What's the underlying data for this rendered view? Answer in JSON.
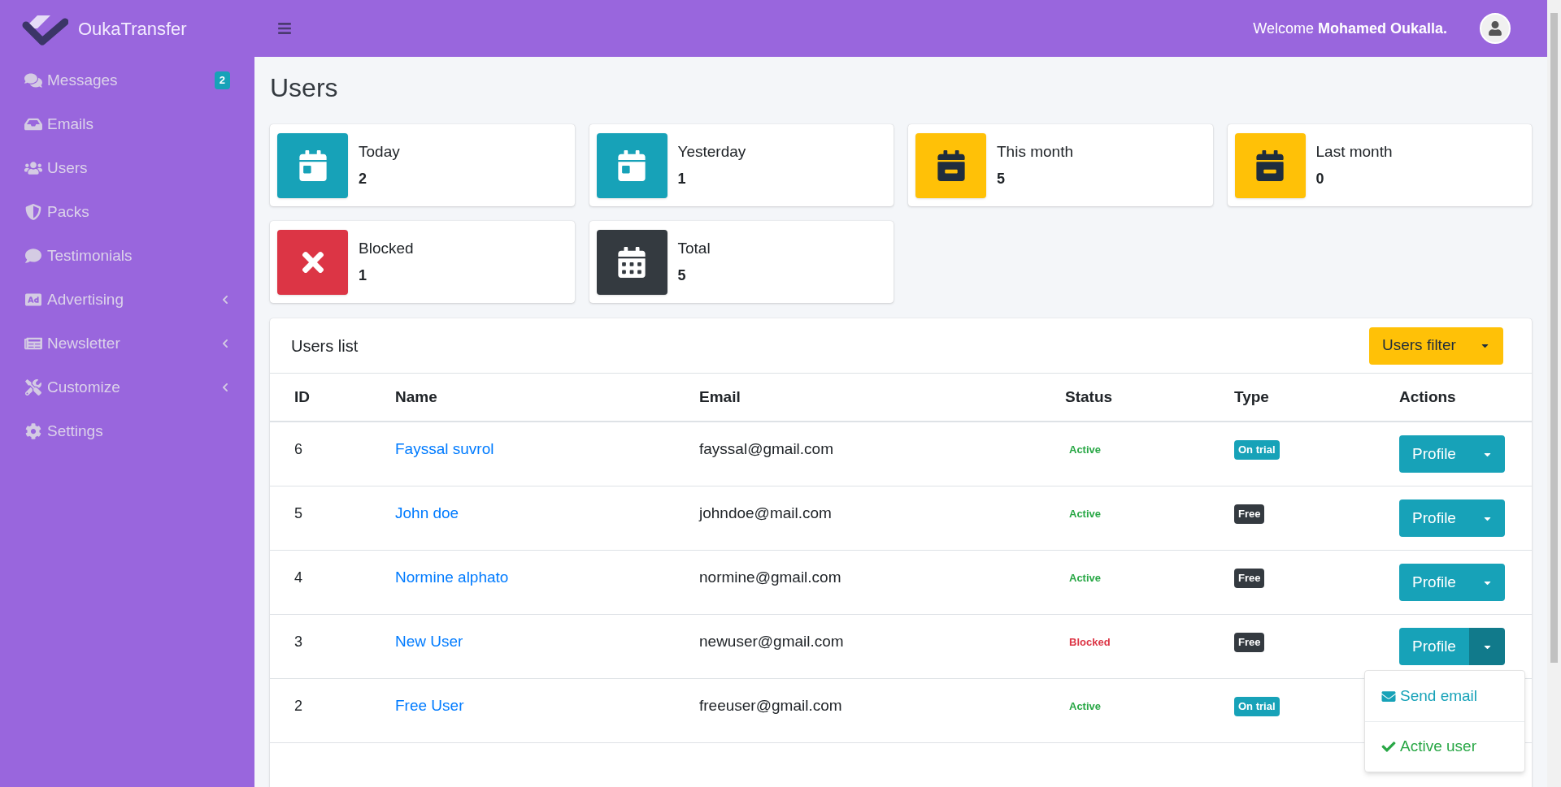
{
  "brand": {
    "name": "OukaTransfer"
  },
  "sidebar": {
    "items": [
      {
        "label": "Messages",
        "badge": "2"
      },
      {
        "label": "Emails"
      },
      {
        "label": "Users"
      },
      {
        "label": "Packs"
      },
      {
        "label": "Testimonials"
      },
      {
        "label": "Advertising",
        "expanded": false
      },
      {
        "label": "Newsletter",
        "expanded": false
      },
      {
        "label": "Customize",
        "expanded": false
      },
      {
        "label": "Settings"
      }
    ]
  },
  "header": {
    "welcome": "Welcome",
    "user_name": "Mohamed Oukalla."
  },
  "page_title": "Users",
  "stats": [
    {
      "label": "Today",
      "value": "2",
      "color": "#17a2b8"
    },
    {
      "label": "Yesterday",
      "value": "1",
      "color": "#17a2b8"
    },
    {
      "label": "This month",
      "value": "5",
      "color": "#ffc107"
    },
    {
      "label": "Last month",
      "value": "0",
      "color": "#ffc107"
    },
    {
      "label": "Blocked",
      "value": "1",
      "color": "#dc3545"
    },
    {
      "label": "Total",
      "value": "5",
      "color": "#343a40"
    }
  ],
  "users_list": {
    "title": "Users list",
    "filter_button": "Users filter",
    "columns": [
      "ID",
      "Name",
      "Email",
      "Status",
      "Type",
      "Actions"
    ],
    "rows": [
      {
        "id": "6",
        "name": "Fayssal suvrol",
        "email": "fayssal@gmail.com",
        "status": {
          "text": "Active",
          "kind": "active"
        },
        "type": {
          "text": "On trial",
          "kind": "trial"
        },
        "action": "Profile",
        "menu_open": false
      },
      {
        "id": "5",
        "name": "John doe",
        "email": "johndoe@mail.com",
        "status": {
          "text": "Active",
          "kind": "active"
        },
        "type": {
          "text": "Free",
          "kind": "free"
        },
        "action": "Profile",
        "menu_open": false
      },
      {
        "id": "4",
        "name": "Normine alphato",
        "email": "normine@gmail.com",
        "status": {
          "text": "Active",
          "kind": "active"
        },
        "type": {
          "text": "Free",
          "kind": "free"
        },
        "action": "Profile",
        "menu_open": false
      },
      {
        "id": "3",
        "name": "New User",
        "email": "newuser@gmail.com",
        "status": {
          "text": "Blocked",
          "kind": "blocked"
        },
        "type": {
          "text": "Free",
          "kind": "free"
        },
        "action": "Profile",
        "menu_open": true
      },
      {
        "id": "2",
        "name": "Free User",
        "email": "freeuser@gmail.com",
        "status": {
          "text": "Active",
          "kind": "active"
        },
        "type": {
          "text": "On trial",
          "kind": "trial"
        }
      }
    ],
    "row_menu": [
      {
        "label": "Send email",
        "kind": "email"
      },
      {
        "label": "Active user",
        "kind": "activate"
      }
    ]
  }
}
